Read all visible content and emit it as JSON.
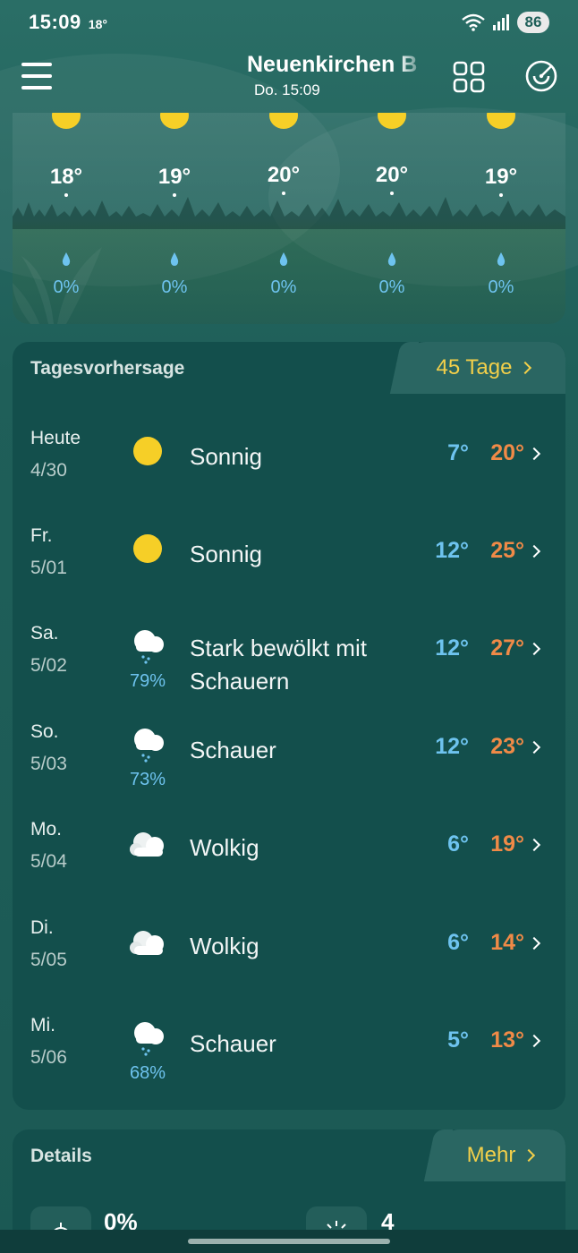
{
  "status": {
    "time": "15:09",
    "temp": "18°",
    "battery": "86"
  },
  "header": {
    "city": "Neuenkirchen B",
    "subtitle": "Do. 15:09"
  },
  "hourly": [
    {
      "temp": "18°",
      "precip": "0%"
    },
    {
      "temp": "19°",
      "precip": "0%"
    },
    {
      "temp": "20°",
      "precip": "0%"
    },
    {
      "temp": "20°",
      "precip": "0%"
    },
    {
      "temp": "19°",
      "precip": "0%"
    }
  ],
  "daily": {
    "title": "Tagesvorhersage",
    "more_label": "45 Tage",
    "days": [
      {
        "name": "Heute",
        "date": "4/30",
        "icon": "sun-icon",
        "desc_line1": "Sonnig",
        "desc_line2": "",
        "rain": "",
        "min": "7°",
        "max": "20°"
      },
      {
        "name": "Fr.",
        "date": "5/01",
        "icon": "sun-icon",
        "desc_line1": "Sonnig",
        "desc_line2": "",
        "rain": "",
        "min": "12°",
        "max": "25°"
      },
      {
        "name": "Sa.",
        "date": "5/02",
        "icon": "shower-cloud-icon",
        "desc_line1": "Stark bewölkt mit",
        "desc_line2": "Schauern",
        "rain": "79%",
        "min": "12°",
        "max": "27°"
      },
      {
        "name": "So.",
        "date": "5/03",
        "icon": "shower-cloud-icon",
        "desc_line1": "Schauer",
        "desc_line2": "",
        "rain": "73%",
        "min": "12°",
        "max": "23°"
      },
      {
        "name": "Mo.",
        "date": "5/04",
        "icon": "cloud-icon",
        "desc_line1": "Wolkig",
        "desc_line2": "",
        "rain": "",
        "min": "6°",
        "max": "19°"
      },
      {
        "name": "Di.",
        "date": "5/05",
        "icon": "cloud-icon",
        "desc_line1": "Wolkig",
        "desc_line2": "",
        "rain": "",
        "min": "6°",
        "max": "14°"
      },
      {
        "name": "Mi.",
        "date": "5/06",
        "icon": "shower-cloud-icon",
        "desc_line1": "Schauer",
        "desc_line2": "",
        "rain": "68%",
        "min": "5°",
        "max": "13°"
      }
    ]
  },
  "details": {
    "title": "Details",
    "more_label": "Mehr",
    "items": [
      {
        "icon": "precipitation-icon",
        "value": "0%"
      },
      {
        "icon": "uv-index-icon",
        "value": "4"
      }
    ]
  },
  "colors": {
    "sun": "#f6cf27",
    "min_temp": "#6ec3ef",
    "max_temp": "#f08a47",
    "more_link": "#f2cf4a",
    "card": "#134f4c"
  }
}
